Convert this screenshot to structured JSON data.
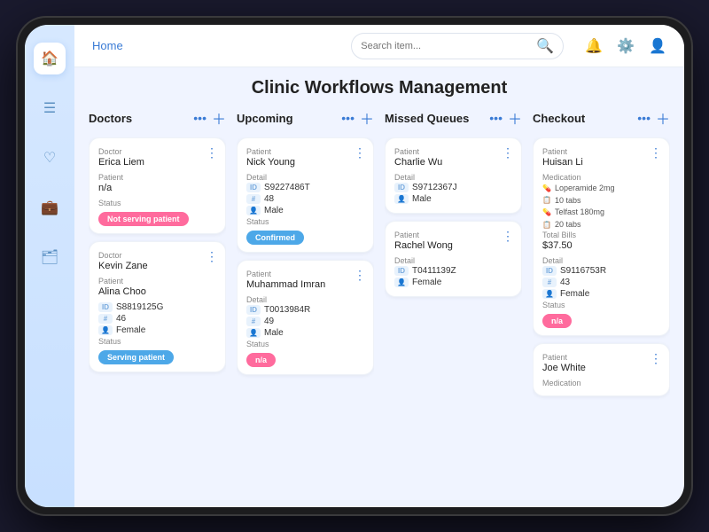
{
  "app": {
    "title": "Clinic Workflows Management"
  },
  "nav": {
    "home_label": "Home",
    "search_placeholder": "Search item...",
    "icons": [
      "bell",
      "gear",
      "user"
    ]
  },
  "sidebar": {
    "icons": [
      "home",
      "list",
      "heart",
      "briefcase",
      "folder"
    ]
  },
  "columns": [
    {
      "id": "doctors",
      "title": "Doctors",
      "cards": [
        {
          "id": "doc1",
          "doctor_label": "Doctor",
          "doctor_name": "Erica Liem",
          "patient_label": "Patient",
          "patient_name": "n/a",
          "status_label": "Status",
          "status_text": "Not serving patient",
          "status_class": "badge-notserving"
        },
        {
          "id": "doc2",
          "doctor_label": "Doctor",
          "doctor_name": "Kevin Zane",
          "patient_label": "Patient",
          "patient_name": "Alina Choo",
          "details": [
            {
              "icon": "ID",
              "value": "S8819125G"
            },
            {
              "icon": "#",
              "value": "46"
            },
            {
              "icon": "👤",
              "value": "Female"
            }
          ],
          "status_label": "Status",
          "status_text": "Serving patient",
          "status_class": "badge-serving"
        }
      ]
    },
    {
      "id": "upcoming",
      "title": "Upcoming",
      "cards": [
        {
          "id": "up1",
          "patient_label": "Patient",
          "patient_name": "Nick Young",
          "detail_label": "Detail",
          "details": [
            {
              "icon": "ID",
              "value": "S9227486T"
            },
            {
              "icon": "#",
              "value": "48"
            },
            {
              "icon": "👤",
              "value": "Male"
            }
          ],
          "status_label": "Status",
          "status_text": "Confirmed",
          "status_class": "badge-confirmed"
        },
        {
          "id": "up2",
          "patient_label": "Patient",
          "patient_name": "Muhammad Imran",
          "detail_label": "Detail",
          "details": [
            {
              "icon": "ID",
              "value": "T0013984R"
            },
            {
              "icon": "#",
              "value": "49"
            },
            {
              "icon": "👤",
              "value": "Male"
            }
          ],
          "status_label": "Status",
          "status_text": "n/a",
          "status_class": "badge-na"
        }
      ]
    },
    {
      "id": "missed",
      "title": "Missed Queues",
      "cards": [
        {
          "id": "mis1",
          "patient_label": "Patient",
          "patient_name": "Charlie Wu",
          "detail_label": "Detail",
          "details": [
            {
              "icon": "ID",
              "value": "S9712367J"
            },
            {
              "icon": "👤",
              "value": "Male"
            }
          ]
        },
        {
          "id": "mis2",
          "patient_label": "Patient",
          "patient_name": "Rachel Wong",
          "detail_label": "Detail",
          "details": [
            {
              "icon": "ID",
              "value": "T0411139Z"
            },
            {
              "icon": "👤",
              "value": "Female"
            }
          ]
        }
      ]
    },
    {
      "id": "checkout",
      "title": "Checkout",
      "cards": [
        {
          "id": "chk1",
          "patient_label": "Patient",
          "patient_name": "Huisan Li",
          "medication_label": "Medication",
          "medications": [
            {
              "icon": "💊",
              "text": "Loperamide 2mg"
            },
            {
              "icon": "📋",
              "text": "10 tabs"
            },
            {
              "icon": "💊",
              "text": "Telfast 180mg"
            },
            {
              "icon": "📋",
              "text": "20 tabs"
            }
          ],
          "total_bills_label": "Total Bills",
          "total_bills": "$37.50",
          "detail_label": "Detail",
          "details": [
            {
              "icon": "ID",
              "value": "S9116753R"
            },
            {
              "icon": "#",
              "value": "43"
            },
            {
              "icon": "👤",
              "value": "Female"
            }
          ],
          "status_label": "Status",
          "status_text": "n/a",
          "status_class": "badge-na"
        },
        {
          "id": "chk2",
          "patient_label": "Patient",
          "patient_name": "Joe White",
          "medication_label": "Medication",
          "medications": []
        }
      ]
    }
  ]
}
